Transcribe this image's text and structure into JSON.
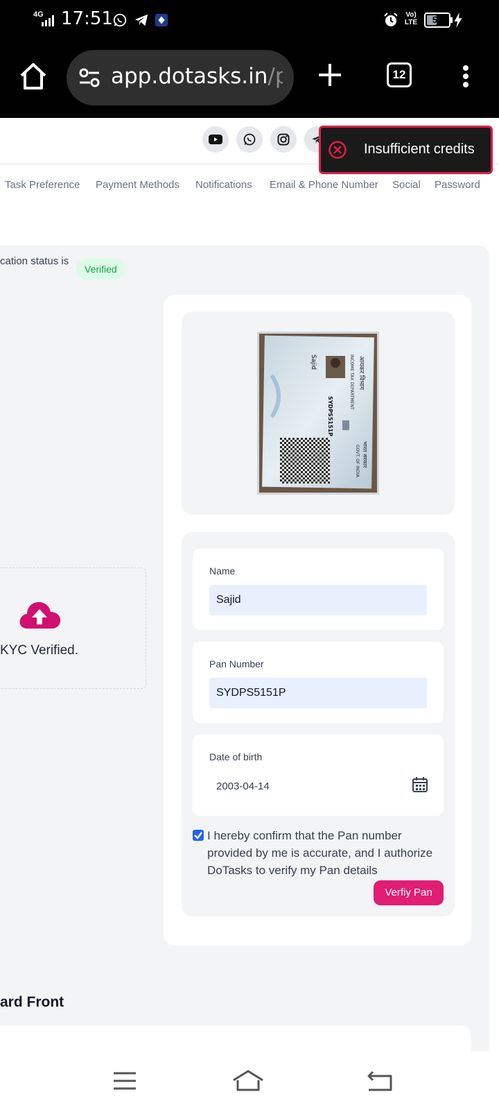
{
  "status_bar": {
    "network": "4G",
    "time": "17:51",
    "volte": "Vo) LTE",
    "battery": "53",
    "battery_level": 0.53,
    "apps": [
      "whatsapp-icon",
      "telegram-icon",
      "shield-app-icon"
    ]
  },
  "browser": {
    "url_main": "app.dotasks.in",
    "url_dim": "/pr",
    "tab_count": "12"
  },
  "header": {
    "social_icons": [
      "youtube-icon",
      "whatsapp-icon",
      "instagram-icon",
      "telegram-icon"
    ]
  },
  "tabs": [
    {
      "label": "Task Preference"
    },
    {
      "label": "Payment Methods"
    },
    {
      "label": "Notifications"
    },
    {
      "label": "Email & Phone Number"
    },
    {
      "label": "Social"
    },
    {
      "label": "Password"
    }
  ],
  "kyc": {
    "status_text": "cation status is",
    "status_badge": "Verified",
    "upload_text": "KYC Verified.",
    "accent": "#d10f6f"
  },
  "pan_form": {
    "name_label": "Name",
    "name_value": "Sajid",
    "pan_label": "Pan Number",
    "pan_value": "SYDPS5151P",
    "dob_label": "Date of birth",
    "dob_value": "2003-04-14",
    "checked": true,
    "confirm_text": "I hereby confirm that the Pan number provided by me is accurate, and I authorize DoTasks to verify my Pan details",
    "verify_button": "Verfiy Pan"
  },
  "pan_card_image": {
    "dept_hindi": "आयकर विभाग",
    "dept_english": "INCOME TAX DEPARTMENT",
    "govt_hindi": "भारत सरकार",
    "govt_english": "GOVT. OF INDIA",
    "pan_text": "SYDPS5151P",
    "name_text": "Sajid"
  },
  "section": {
    "title": "ard Front"
  },
  "toast": {
    "message": "Insufficient credits",
    "color": "#e11d48"
  }
}
